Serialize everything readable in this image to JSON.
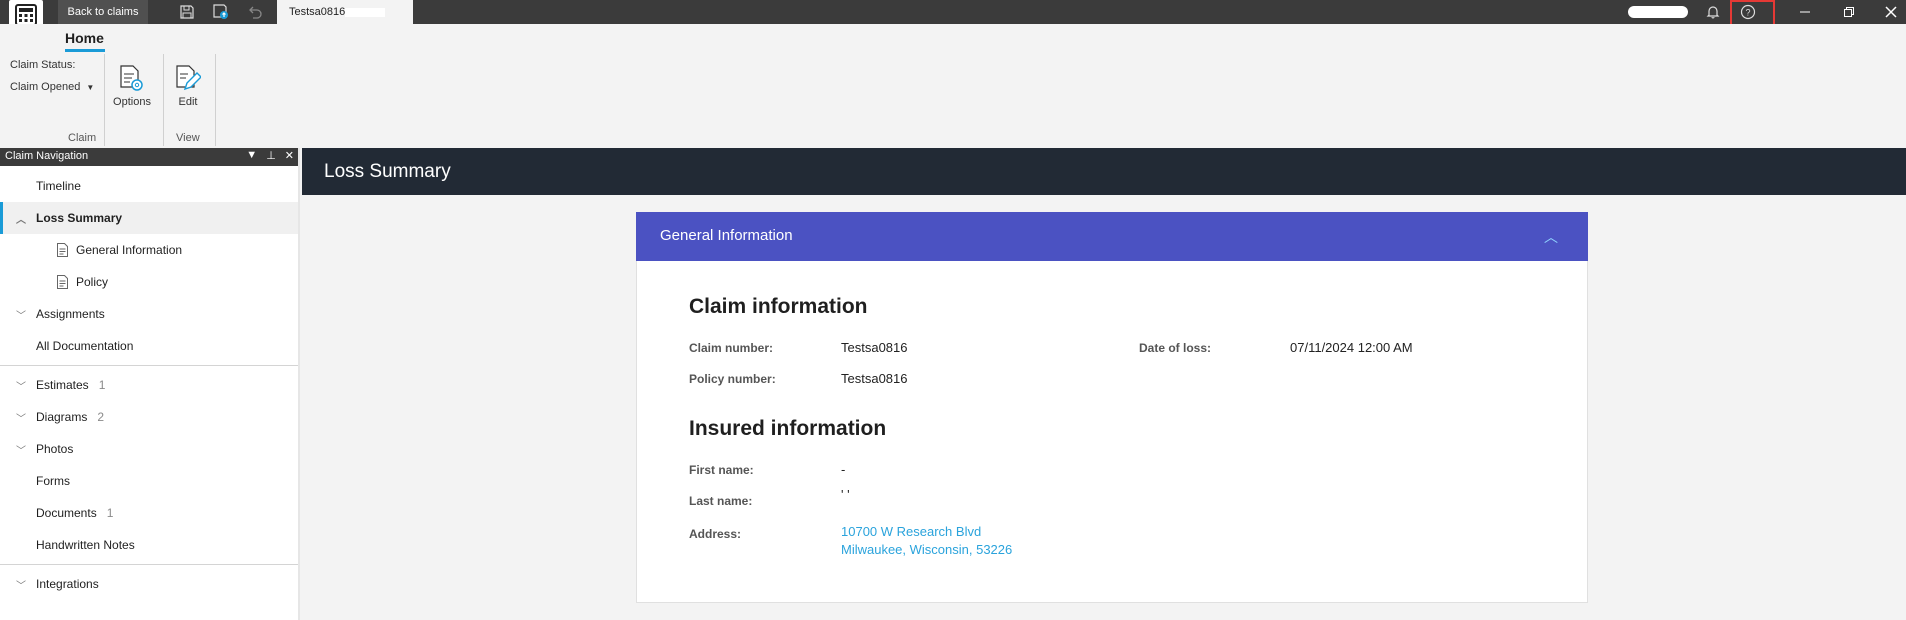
{
  "titlebar": {
    "back_label": "Back to claims",
    "doc_tab_label": "Testsa0816,",
    "icons": [
      "save-icon",
      "save-upload-icon",
      "undo-icon",
      "bell-icon",
      "help-icon",
      "minimize-icon",
      "restore-icon",
      "close-icon"
    ]
  },
  "ribbon": {
    "tab": "Home",
    "claim_status_label": "Claim Status:",
    "claim_status_value": "Claim Opened",
    "options_label": "Options",
    "edit_label": "Edit",
    "group_claim": "Claim",
    "group_view": "View"
  },
  "sidebar": {
    "title": "Claim Navigation",
    "items": [
      {
        "label": "Timeline",
        "count": ""
      },
      {
        "label": "Loss Summary",
        "count": ""
      },
      {
        "label": "General Information",
        "count": ""
      },
      {
        "label": "Policy",
        "count": ""
      },
      {
        "label": "Assignments",
        "count": ""
      },
      {
        "label": "All Documentation",
        "count": ""
      },
      {
        "label": "Estimates",
        "count": "1"
      },
      {
        "label": "Diagrams",
        "count": "2"
      },
      {
        "label": "Photos",
        "count": ""
      },
      {
        "label": "Forms",
        "count": ""
      },
      {
        "label": "Documents",
        "count": "1"
      },
      {
        "label": "Handwritten Notes",
        "count": ""
      },
      {
        "label": "Integrations",
        "count": ""
      }
    ]
  },
  "main": {
    "title": "Loss Summary",
    "card_title": "General Information",
    "claim_section": "Claim information",
    "claim_number_label": "Claim number:",
    "claim_number": "Testsa0816",
    "date_of_loss_label": "Date of loss:",
    "date_of_loss": "07/11/2024 12:00 AM",
    "policy_number_label": "Policy number:",
    "policy_number": "Testsa0816",
    "insured_section": "Insured information",
    "first_name_label": "First name:",
    "first_name": "-",
    "last_name_label": "Last name:",
    "last_name": "' '",
    "address_label": "Address:",
    "address_line1": "10700 W Research Blvd",
    "address_line2": "Milwaukee, Wisconsin, 53226"
  },
  "colors": {
    "titlebar": "#3b3b3b",
    "accent": "#1a9bd7",
    "card_header": "#4b52c2",
    "page_header": "#222a35",
    "link": "#2aa3dc",
    "highlight": "#e53935"
  }
}
